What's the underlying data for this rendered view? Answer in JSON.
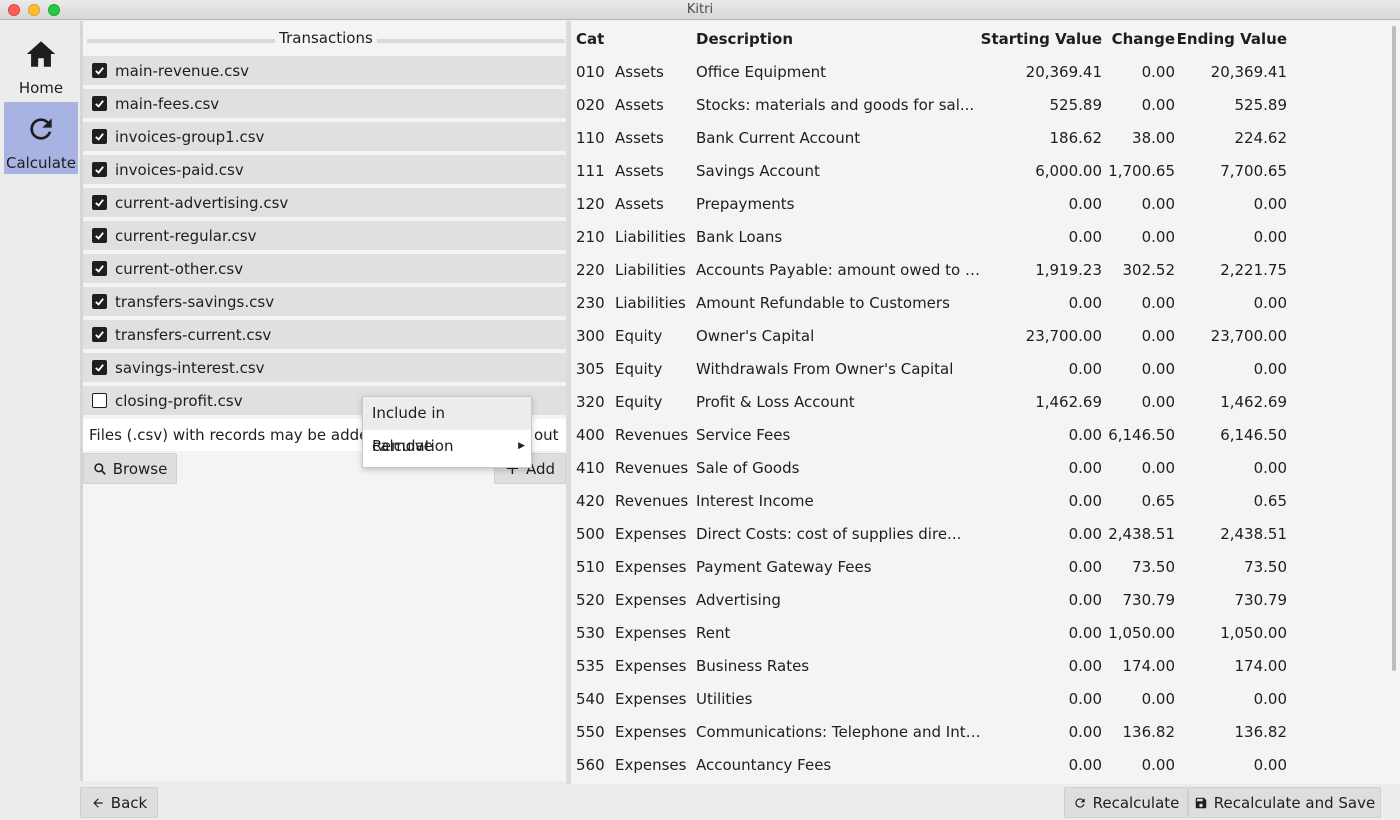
{
  "window": {
    "title": "Kitri"
  },
  "nav": {
    "home_label": "Home",
    "calculate_label": "Calculate",
    "active_color": "#a9b3e3"
  },
  "files": {
    "header": "Transactions",
    "items": [
      {
        "name": "main-revenue.csv",
        "checked": true
      },
      {
        "name": "main-fees.csv",
        "checked": true
      },
      {
        "name": "invoices-group1.csv",
        "checked": true
      },
      {
        "name": "invoices-paid.csv",
        "checked": true
      },
      {
        "name": "current-advertising.csv",
        "checked": true
      },
      {
        "name": "current-regular.csv",
        "checked": true
      },
      {
        "name": "current-other.csv",
        "checked": true
      },
      {
        "name": "transfers-savings.csv",
        "checked": true
      },
      {
        "name": "transfers-current.csv",
        "checked": true
      },
      {
        "name": "savings-interest.csv",
        "checked": true
      },
      {
        "name": "closing-profit.csv",
        "checked": false
      }
    ],
    "hint": "Files (.csv) with records may be added t",
    "hint_tail": "out",
    "browse_label": "Browse",
    "add_label": "Add"
  },
  "context_menu": {
    "items": [
      {
        "label": "Include in calculation"
      },
      {
        "label": "Remove"
      }
    ]
  },
  "table": {
    "headers": {
      "cat": "Cat",
      "description": "Description",
      "starting": "Starting Value",
      "change": "Change",
      "ending": "Ending Value"
    },
    "rows": [
      {
        "cat": "010",
        "type": "Assets",
        "description": "Office Equipment",
        "starting": "20,369.41",
        "change": "0.00",
        "ending": "20,369.41"
      },
      {
        "cat": "020",
        "type": "Assets",
        "description": "Stocks: materials and goods for sal...",
        "starting": "525.89",
        "change": "0.00",
        "ending": "525.89"
      },
      {
        "cat": "110",
        "type": "Assets",
        "description": "Bank Current Account",
        "starting": "186.62",
        "change": "38.00",
        "ending": "224.62"
      },
      {
        "cat": "111",
        "type": "Assets",
        "description": "Savings Account",
        "starting": "6,000.00",
        "change": "1,700.65",
        "ending": "7,700.65"
      },
      {
        "cat": "120",
        "type": "Assets",
        "description": "Prepayments",
        "starting": "0.00",
        "change": "0.00",
        "ending": "0.00"
      },
      {
        "cat": "210",
        "type": "Liabilities",
        "description": "Bank Loans",
        "starting": "0.00",
        "change": "0.00",
        "ending": "0.00"
      },
      {
        "cat": "220",
        "type": "Liabilities",
        "description": "Accounts Payable: amount owed to su...",
        "starting": "1,919.23",
        "change": "302.52",
        "ending": "2,221.75"
      },
      {
        "cat": "230",
        "type": "Liabilities",
        "description": "Amount Refundable to Customers",
        "starting": "0.00",
        "change": "0.00",
        "ending": "0.00"
      },
      {
        "cat": "300",
        "type": "Equity",
        "description": "Owner's Capital",
        "starting": "23,700.00",
        "change": "0.00",
        "ending": "23,700.00"
      },
      {
        "cat": "305",
        "type": "Equity",
        "description": "Withdrawals From Owner's Capital",
        "starting": "0.00",
        "change": "0.00",
        "ending": "0.00"
      },
      {
        "cat": "320",
        "type": "Equity",
        "description": "Profit & Loss Account",
        "starting": "1,462.69",
        "change": "0.00",
        "ending": "1,462.69"
      },
      {
        "cat": "400",
        "type": "Revenues",
        "description": "Service Fees",
        "starting": "0.00",
        "change": "6,146.50",
        "ending": "6,146.50"
      },
      {
        "cat": "410",
        "type": "Revenues",
        "description": "Sale of Goods",
        "starting": "0.00",
        "change": "0.00",
        "ending": "0.00"
      },
      {
        "cat": "420",
        "type": "Revenues",
        "description": "Interest Income",
        "starting": "0.00",
        "change": "0.65",
        "ending": "0.65"
      },
      {
        "cat": "500",
        "type": "Expenses",
        "description": "Direct Costs: cost of supplies dire...",
        "starting": "0.00",
        "change": "2,438.51",
        "ending": "2,438.51"
      },
      {
        "cat": "510",
        "type": "Expenses",
        "description": "Payment Gateway Fees",
        "starting": "0.00",
        "change": "73.50",
        "ending": "73.50"
      },
      {
        "cat": "520",
        "type": "Expenses",
        "description": "Advertising",
        "starting": "0.00",
        "change": "730.79",
        "ending": "730.79"
      },
      {
        "cat": "530",
        "type": "Expenses",
        "description": "Rent",
        "starting": "0.00",
        "change": "1,050.00",
        "ending": "1,050.00"
      },
      {
        "cat": "535",
        "type": "Expenses",
        "description": "Business Rates",
        "starting": "0.00",
        "change": "174.00",
        "ending": "174.00"
      },
      {
        "cat": "540",
        "type": "Expenses",
        "description": "Utilities",
        "starting": "0.00",
        "change": "0.00",
        "ending": "0.00"
      },
      {
        "cat": "550",
        "type": "Expenses",
        "description": "Communications: Telephone and Inter...",
        "starting": "0.00",
        "change": "136.82",
        "ending": "136.82"
      },
      {
        "cat": "560",
        "type": "Expenses",
        "description": "Accountancy Fees",
        "starting": "0.00",
        "change": "0.00",
        "ending": "0.00"
      }
    ]
  },
  "bottom": {
    "back_label": "Back",
    "recalculate_label": "Recalculate",
    "recalculate_save_label": "Recalculate and Save"
  }
}
